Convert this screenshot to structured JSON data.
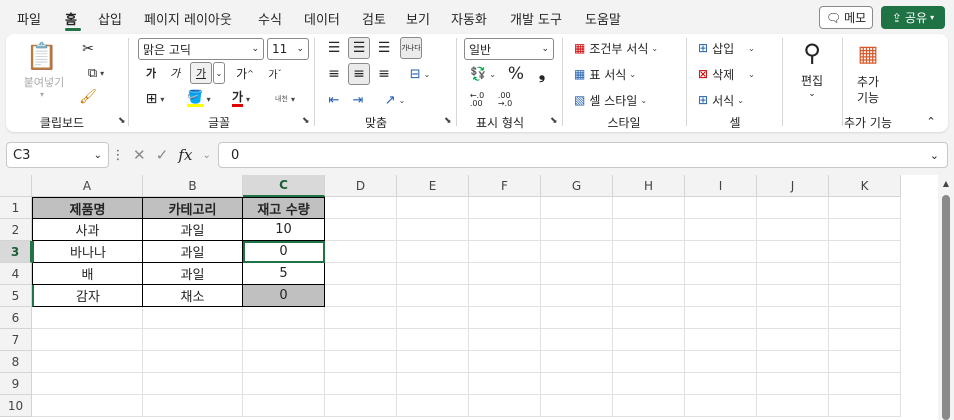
{
  "menu": {
    "tabs": [
      "파일",
      "홈",
      "삽입",
      "페이지 레이아웃",
      "수식",
      "데이터",
      "검토",
      "보기",
      "자동화",
      "개발 도구",
      "도움말"
    ],
    "memo": "메모",
    "share": "공유"
  },
  "ribbon": {
    "clipboard": {
      "paste": "붙여넣기",
      "label": "클립보드"
    },
    "font": {
      "name": "맑은 고딕",
      "size": "11",
      "ga1": "가",
      "ga2": "가",
      "ga3": "가",
      "grow": "가",
      "shrink": "가",
      "phon": "내천",
      "label": "글꼴"
    },
    "align": {
      "wrap": "가나다",
      "label": "맞춤"
    },
    "number": {
      "format": "일반",
      "label": "표시 형식"
    },
    "styles": {
      "cond": "조건부 서식",
      "table": "표 서식",
      "cell": "셀 스타일",
      "label": "스타일"
    },
    "cells": {
      "insert": "삽입",
      "delete": "삭제",
      "format": "서식",
      "label": "셀"
    },
    "edit": {
      "label": "편집"
    },
    "addins": {
      "label1": "추가",
      "label2": "기능",
      "group": "추가 기능"
    }
  },
  "formula_bar": {
    "name_box": "C3",
    "fx": "fx",
    "value": "0"
  },
  "sheet": {
    "columns": [
      "A",
      "B",
      "C",
      "D",
      "E",
      "F",
      "G",
      "H",
      "I",
      "J",
      "K"
    ],
    "rows": [
      "1",
      "2",
      "3",
      "4",
      "5",
      "6",
      "7",
      "8",
      "9",
      "10"
    ],
    "cells": [
      [
        "제품명",
        "카테고리",
        "재고 수량"
      ],
      [
        "사과",
        "과일",
        "10"
      ],
      [
        "바나나",
        "과일",
        "0"
      ],
      [
        "배",
        "과일",
        "5"
      ],
      [
        "감자",
        "채소",
        "0"
      ]
    ],
    "selected": "C3"
  },
  "colors": {
    "accent": "#217346",
    "share": "#1f7244",
    "header_fill": "#c0c0c0"
  }
}
